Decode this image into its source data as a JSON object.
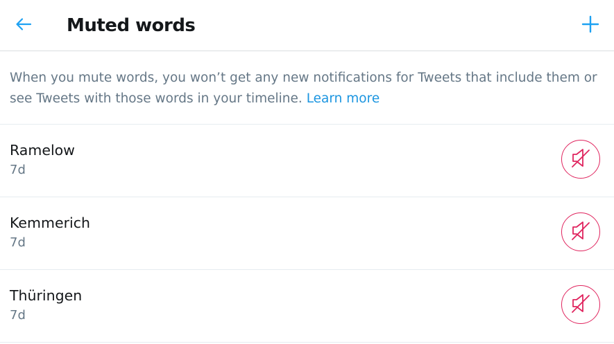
{
  "header": {
    "title": "Muted words",
    "back_icon": "arrow-left-icon",
    "add_icon": "plus-icon",
    "accent_color": "#1da1f2"
  },
  "description": {
    "text": "When you mute words, you won’t get any new notifications for Tweets that include them or see Tweets with those words in your timeline. ",
    "link_label": "Learn more",
    "link_color": "#1b95e0"
  },
  "muted_words": [
    {
      "word": "Ramelow",
      "age": "7d",
      "action_icon": "unmute-speaker-icon"
    },
    {
      "word": "Kemmerich",
      "age": "7d",
      "action_icon": "unmute-speaker-icon"
    },
    {
      "word": "Thüringen",
      "age": "7d",
      "action_icon": "unmute-speaker-icon"
    }
  ],
  "colors": {
    "unmute": "#e0245e",
    "secondary_text": "#657786",
    "primary_text": "#14171a"
  }
}
